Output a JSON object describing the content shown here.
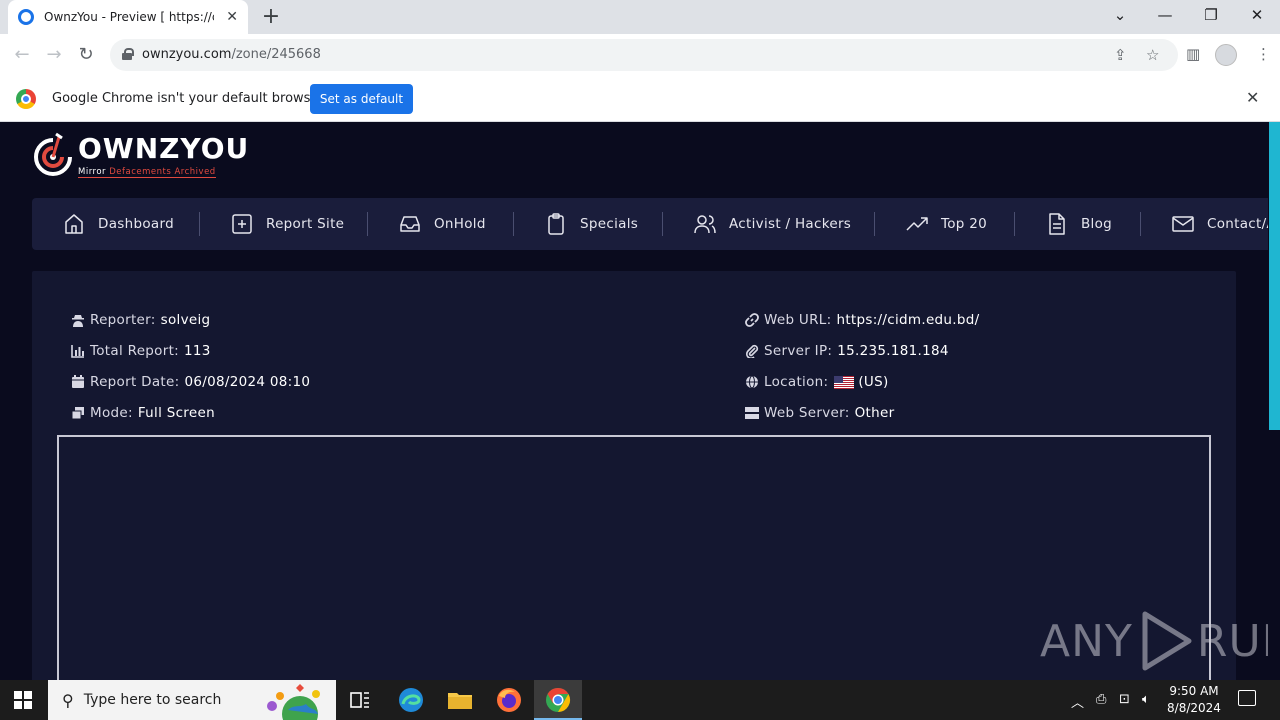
{
  "browser": {
    "tab_title": "OwnzYou - Preview [ https://cidm.edu.bd/ ]",
    "tab_close": "✕",
    "new_tab": "+",
    "url_host": "ownzyou.com",
    "url_path": "/zone/245668",
    "infobar_text": "Google Chrome isn't your default browser",
    "set_default_label": "Set as default",
    "infobar_close": "✕"
  },
  "site": {
    "logo_title": "OWNZYOU",
    "logo_subtitle_a": "Mirror ",
    "logo_subtitle_b": "Defacements Archived",
    "nav": [
      {
        "label": "Dashboard"
      },
      {
        "label": "Report Site"
      },
      {
        "label": "OnHold"
      },
      {
        "label": "Specials"
      },
      {
        "label": "Activist / Hackers"
      },
      {
        "label": "Top 20"
      },
      {
        "label": "Blog"
      },
      {
        "label": "Contact/About"
      }
    ]
  },
  "report": {
    "reporter_label": "Reporter:",
    "reporter_value": "solveig",
    "total_label": "Total Report:",
    "total_value": "113",
    "date_label": "Report Date:",
    "date_value": "06/08/2024 08:10",
    "mode_label": "Mode:",
    "mode_value": "Full Screen",
    "url_label": "Web URL:",
    "url_value": "https://cidm.edu.bd/",
    "ip_label": "Server IP:",
    "ip_value": "15.235.181.184",
    "location_label": "Location:",
    "location_value": "(US)",
    "server_label": "Web Server:",
    "server_value": "Other"
  },
  "watermark": {
    "left": "ANY",
    "right": "RUN"
  },
  "taskbar": {
    "search_placeholder": "Type here to search",
    "time": "9:50 AM",
    "date": "8/8/2024"
  },
  "colors": {
    "page_bg": "#0a0b1e",
    "nav_bg": "#1a1d3b",
    "card_bg": "#141730",
    "accent_red": "#e04a3f",
    "scroll_accent": "#1fb6d1",
    "chrome_blue": "#1a73e8"
  }
}
